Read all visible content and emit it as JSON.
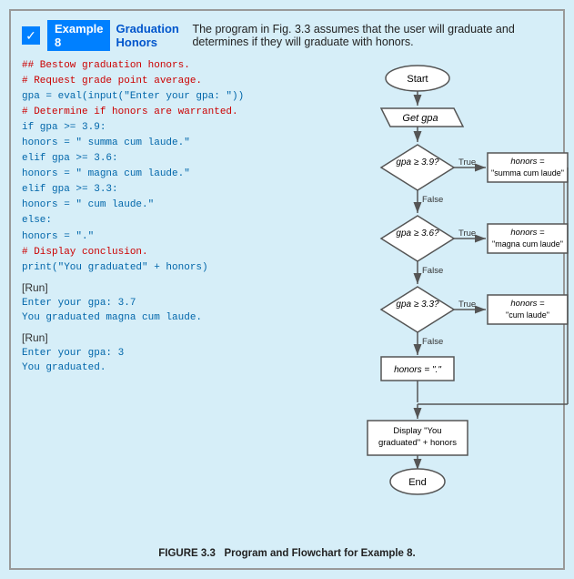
{
  "header": {
    "example_num": "Example 8",
    "title": "Graduation Honors",
    "description": "The program in Fig. 3.3 assumes that the user will graduate and determines if they will graduate with honors."
  },
  "code": {
    "comment1": "## Bestow graduation honors.",
    "comment2": "# Request grade point average.",
    "line1": "gpa = eval(input(\"Enter your gpa: \"))",
    "comment3": "# Determine if honors are warranted.",
    "line2": "if gpa >= 3.9:",
    "line3": "    honors = \" summa cum laude.\"",
    "line4": "elif gpa >= 3.6:",
    "line5": "    honors = \" magna cum laude.\"",
    "line6": "elif gpa >= 3.3:",
    "line7": "    honors = \" cum laude.\"",
    "line8": "else:",
    "line9": "    honors = \".\"",
    "comment4": "# Display conclusion.",
    "line10": "print(\"You graduated\" + honors)"
  },
  "run1": {
    "label": "[Run]",
    "input_prompt": "Enter your gpa: 3.7",
    "output": "You graduated magna cum laude."
  },
  "run2": {
    "label": "[Run]",
    "input_prompt": "Enter your gpa: 3",
    "output": "You graduated."
  },
  "flowchart": {
    "start": "Start",
    "get_gpa": "Get gpa",
    "diamond1": "gpa ≥ 3.9?",
    "diamond2": "gpa ≥ 3.6?",
    "diamond3": "gpa ≥ 3.3?",
    "box1": "honors = \"summa cum laude\"",
    "box2": "honors = \"magna cum laude\"",
    "box3": "honors = \"cum laude\"",
    "box4": "honors = \".\"",
    "display": "Display \"You graduated\" + honors",
    "end": "End",
    "true_label": "True",
    "false_label": "False"
  },
  "figure": {
    "number": "FIGURE 3.3",
    "caption": "Program and Flowchart for Example 8."
  }
}
